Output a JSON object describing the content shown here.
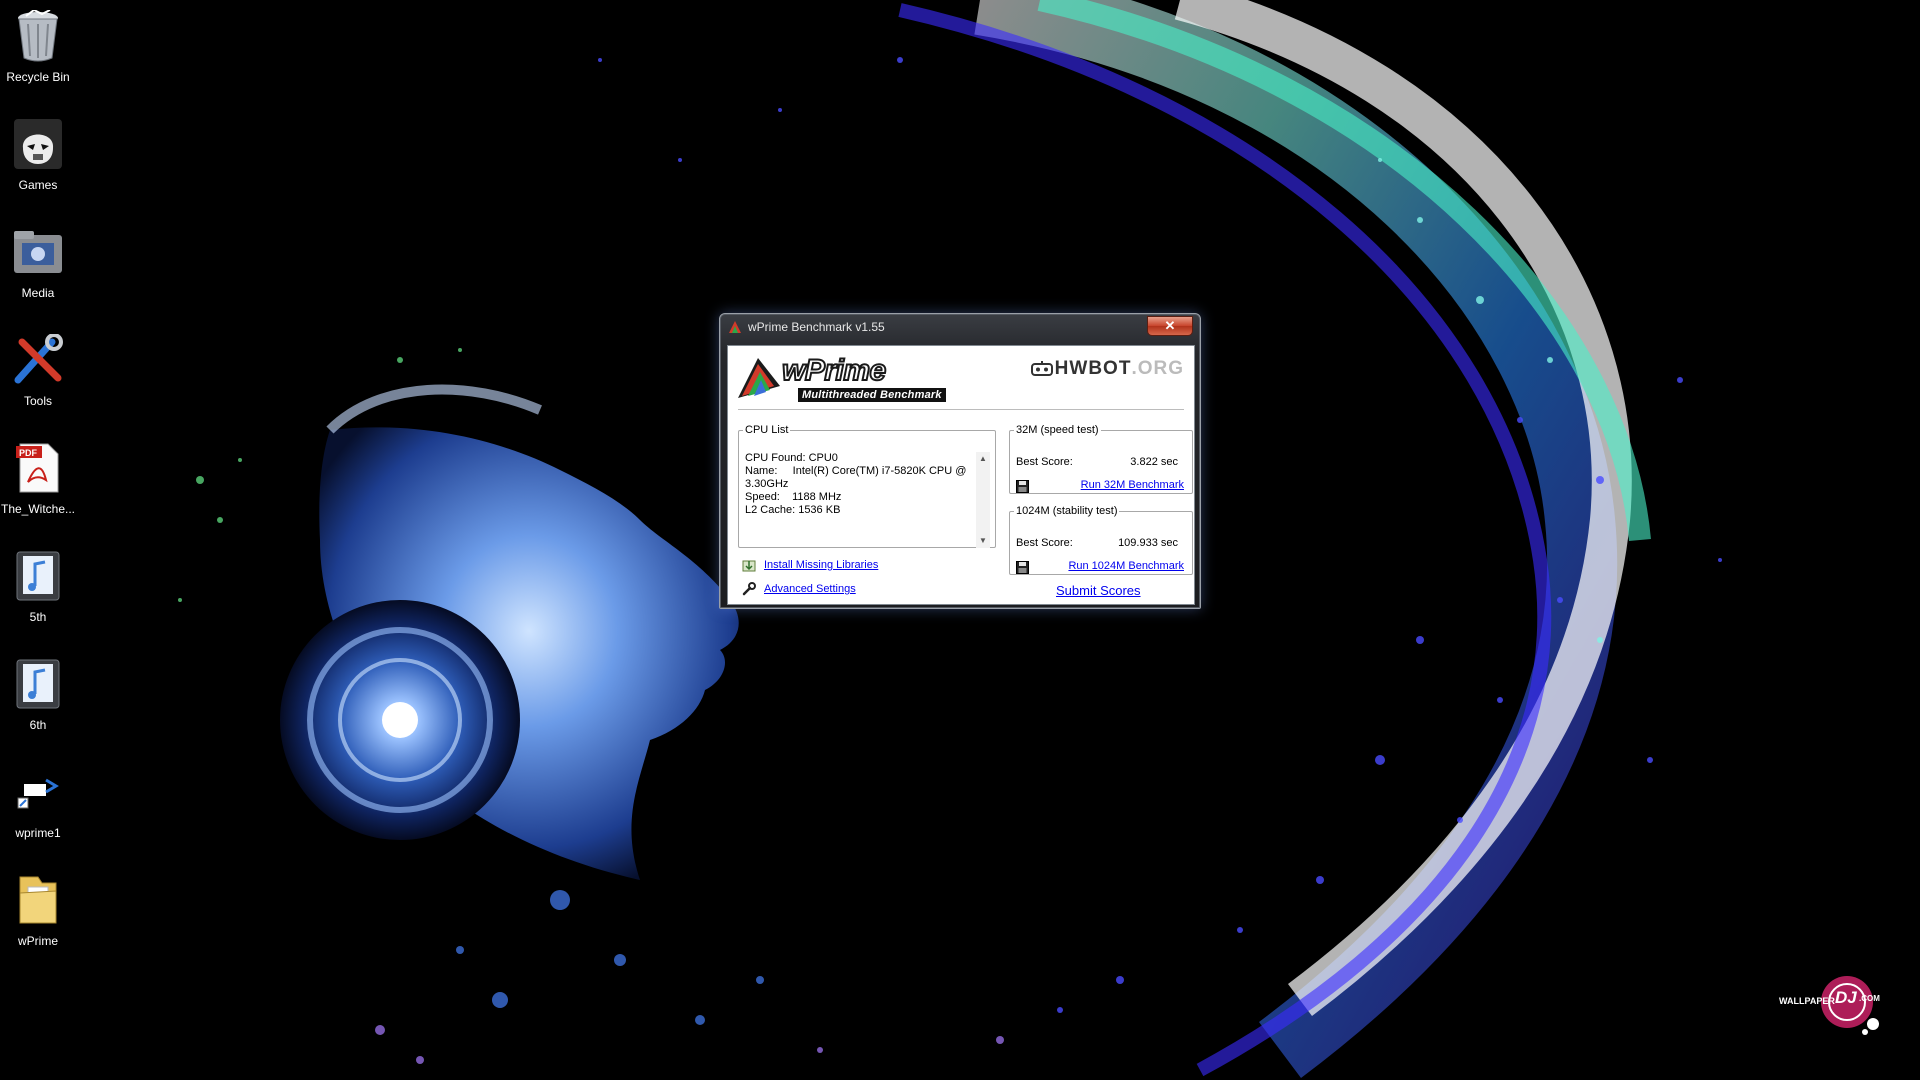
{
  "desktop": {
    "icons": [
      {
        "label": "Recycle Bin",
        "icon": "recycle-bin-icon"
      },
      {
        "label": "Games",
        "icon": "stormtrooper-icon"
      },
      {
        "label": "Media",
        "icon": "media-folder-icon"
      },
      {
        "label": "Tools",
        "icon": "tools-icon"
      },
      {
        "label": "The_Witche...",
        "icon": "pdf-file-icon"
      },
      {
        "label": "5th",
        "icon": "audio-file-icon"
      },
      {
        "label": "6th",
        "icon": "audio-file-icon"
      },
      {
        "label": "wprime1",
        "icon": "wprime-shortcut-icon"
      },
      {
        "label": "wPrime",
        "icon": "folder-icon"
      }
    ],
    "watermark": {
      "line1": "WALLPAPER",
      "line2": "DJ",
      "line3": ".COM"
    }
  },
  "window": {
    "title": "wPrime Benchmark v1.55",
    "close_label": "✕",
    "logo": {
      "word": "wPrime",
      "subtitle": "Multithreaded Benchmark"
    },
    "hwbot": {
      "hw": "HWBOT",
      "org": ".ORG"
    },
    "cpu_list": {
      "legend": "CPU List",
      "lines": [
        "CPU Found: CPU0",
        "Name:     Intel(R) Core(TM) i7-5820K CPU @",
        "3.30GHz",
        "Speed:    1188 MHz",
        "L2 Cache: 1536 KB"
      ]
    },
    "test_32m": {
      "legend": "32M (speed test)",
      "best_score_label": "Best Score:",
      "best_score_value": "3.822 sec",
      "run_label": "Run 32M Benchmark"
    },
    "test_1024m": {
      "legend": "1024M (stability test)",
      "best_score_label": "Best Score:",
      "best_score_value": "109.933 sec",
      "run_label": "Run 1024M Benchmark"
    },
    "install_libraries_label": "Install Missing Libraries",
    "advanced_settings_label": "Advanced Settings",
    "submit_label": "Submit Scores"
  }
}
